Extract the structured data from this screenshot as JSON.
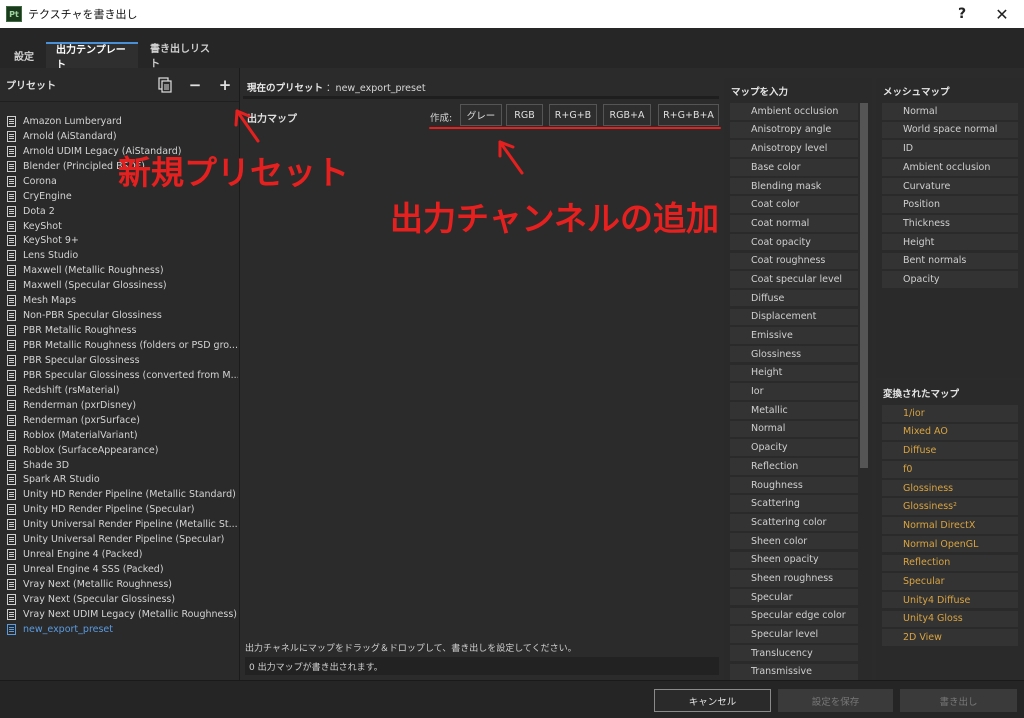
{
  "window": {
    "app_icon": "Pt",
    "title": "テクスチャを書き出し",
    "help": "?",
    "close": "✕"
  },
  "tabs": [
    {
      "label": "設定"
    },
    {
      "label": "出力テンプレート"
    },
    {
      "label": "書き出しリスト"
    }
  ],
  "presets": {
    "header": "プリセット",
    "icons": {
      "duplicate": "duplicate-icon",
      "remove": "−",
      "add": "+"
    },
    "items": [
      "Amazon Lumberyard",
      "Arnold (AiStandard)",
      "Arnold UDIM Legacy (AiStandard)",
      "Blender (Principled BSDF)",
      "Corona",
      "CryEngine",
      "Dota 2",
      "KeyShot",
      "KeyShot 9+",
      "Lens Studio",
      "Maxwell (Metallic Roughness)",
      "Maxwell (Specular Glossiness)",
      "Mesh Maps",
      "Non-PBR Specular Glossiness",
      "PBR Metallic Roughness",
      "PBR Metallic Roughness (folders or PSD gro...",
      "PBR Specular Glossiness",
      "PBR Specular Glossiness (converted from M...",
      "Redshift (rsMaterial)",
      "Renderman (pxrDisney)",
      "Renderman (pxrSurface)",
      "Roblox (MaterialVariant)",
      "Roblox (SurfaceAppearance)",
      "Shade 3D",
      "Spark AR Studio",
      "Unity HD Render Pipeline (Metallic Standard)",
      "Unity HD Render Pipeline (Specular)",
      "Unity Universal Render Pipeline (Metallic St...",
      "Unity Universal Render Pipeline (Specular)",
      "Unreal Engine 4 (Packed)",
      "Unreal Engine 4 SSS (Packed)",
      "Vray Next (Metallic Roughness)",
      "Vray Next (Specular Glossiness)",
      "Vray Next UDIM Legacy (Metallic Roughness)",
      "new_export_preset"
    ],
    "selected_index": 34
  },
  "center": {
    "current_preset_label": "現在のプリセット",
    "current_preset_value": "：new_export_preset",
    "output_maps_label": "出力マップ",
    "create_label": "作成:",
    "channel_buttons": [
      "グレー",
      "RGB",
      "R+G+B",
      "RGB+A",
      "R+G+B+A"
    ],
    "hint": "出力チャネルにマップをドラッグ＆ドロップして、書き出しを設定してください。",
    "status": "0 出力マップが書き出されます。"
  },
  "input_maps": {
    "title": "マップを入力",
    "items": [
      "Ambient occlusion",
      "Anisotropy angle",
      "Anisotropy level",
      "Base color",
      "Blending mask",
      "Coat color",
      "Coat normal",
      "Coat opacity",
      "Coat roughness",
      "Coat specular level",
      "Diffuse",
      "Displacement",
      "Emissive",
      "Glossiness",
      "Height",
      "Ior",
      "Metallic",
      "Normal",
      "Opacity",
      "Reflection",
      "Roughness",
      "Scattering",
      "Scattering color",
      "Sheen color",
      "Sheen opacity",
      "Sheen roughness",
      "Specular",
      "Specular edge color",
      "Specular level",
      "Translucency",
      "Transmissive"
    ]
  },
  "mesh_maps": {
    "title": "メッシュマップ",
    "items": [
      "Normal",
      "World space normal",
      "ID",
      "Ambient occlusion",
      "Curvature",
      "Position",
      "Thickness",
      "Height",
      "Bent normals",
      "Opacity"
    ]
  },
  "converted_maps": {
    "title": "変換されたマップ",
    "color": "#d9a441",
    "items": [
      "1/ior",
      "Mixed AO",
      "Diffuse",
      "f0",
      "Glossiness",
      "Glossiness²",
      "Normal DirectX",
      "Normal OpenGL",
      "Reflection",
      "Specular",
      "Unity4 Diffuse",
      "Unity4 Gloss",
      "2D View"
    ]
  },
  "footer": {
    "cancel": "キャンセル",
    "save": "設定を保存",
    "export": "書き出し"
  },
  "annotations": {
    "color": "#e5201f",
    "new_preset": "新規プリセット",
    "add_channel": "出力チャンネルの追加"
  }
}
